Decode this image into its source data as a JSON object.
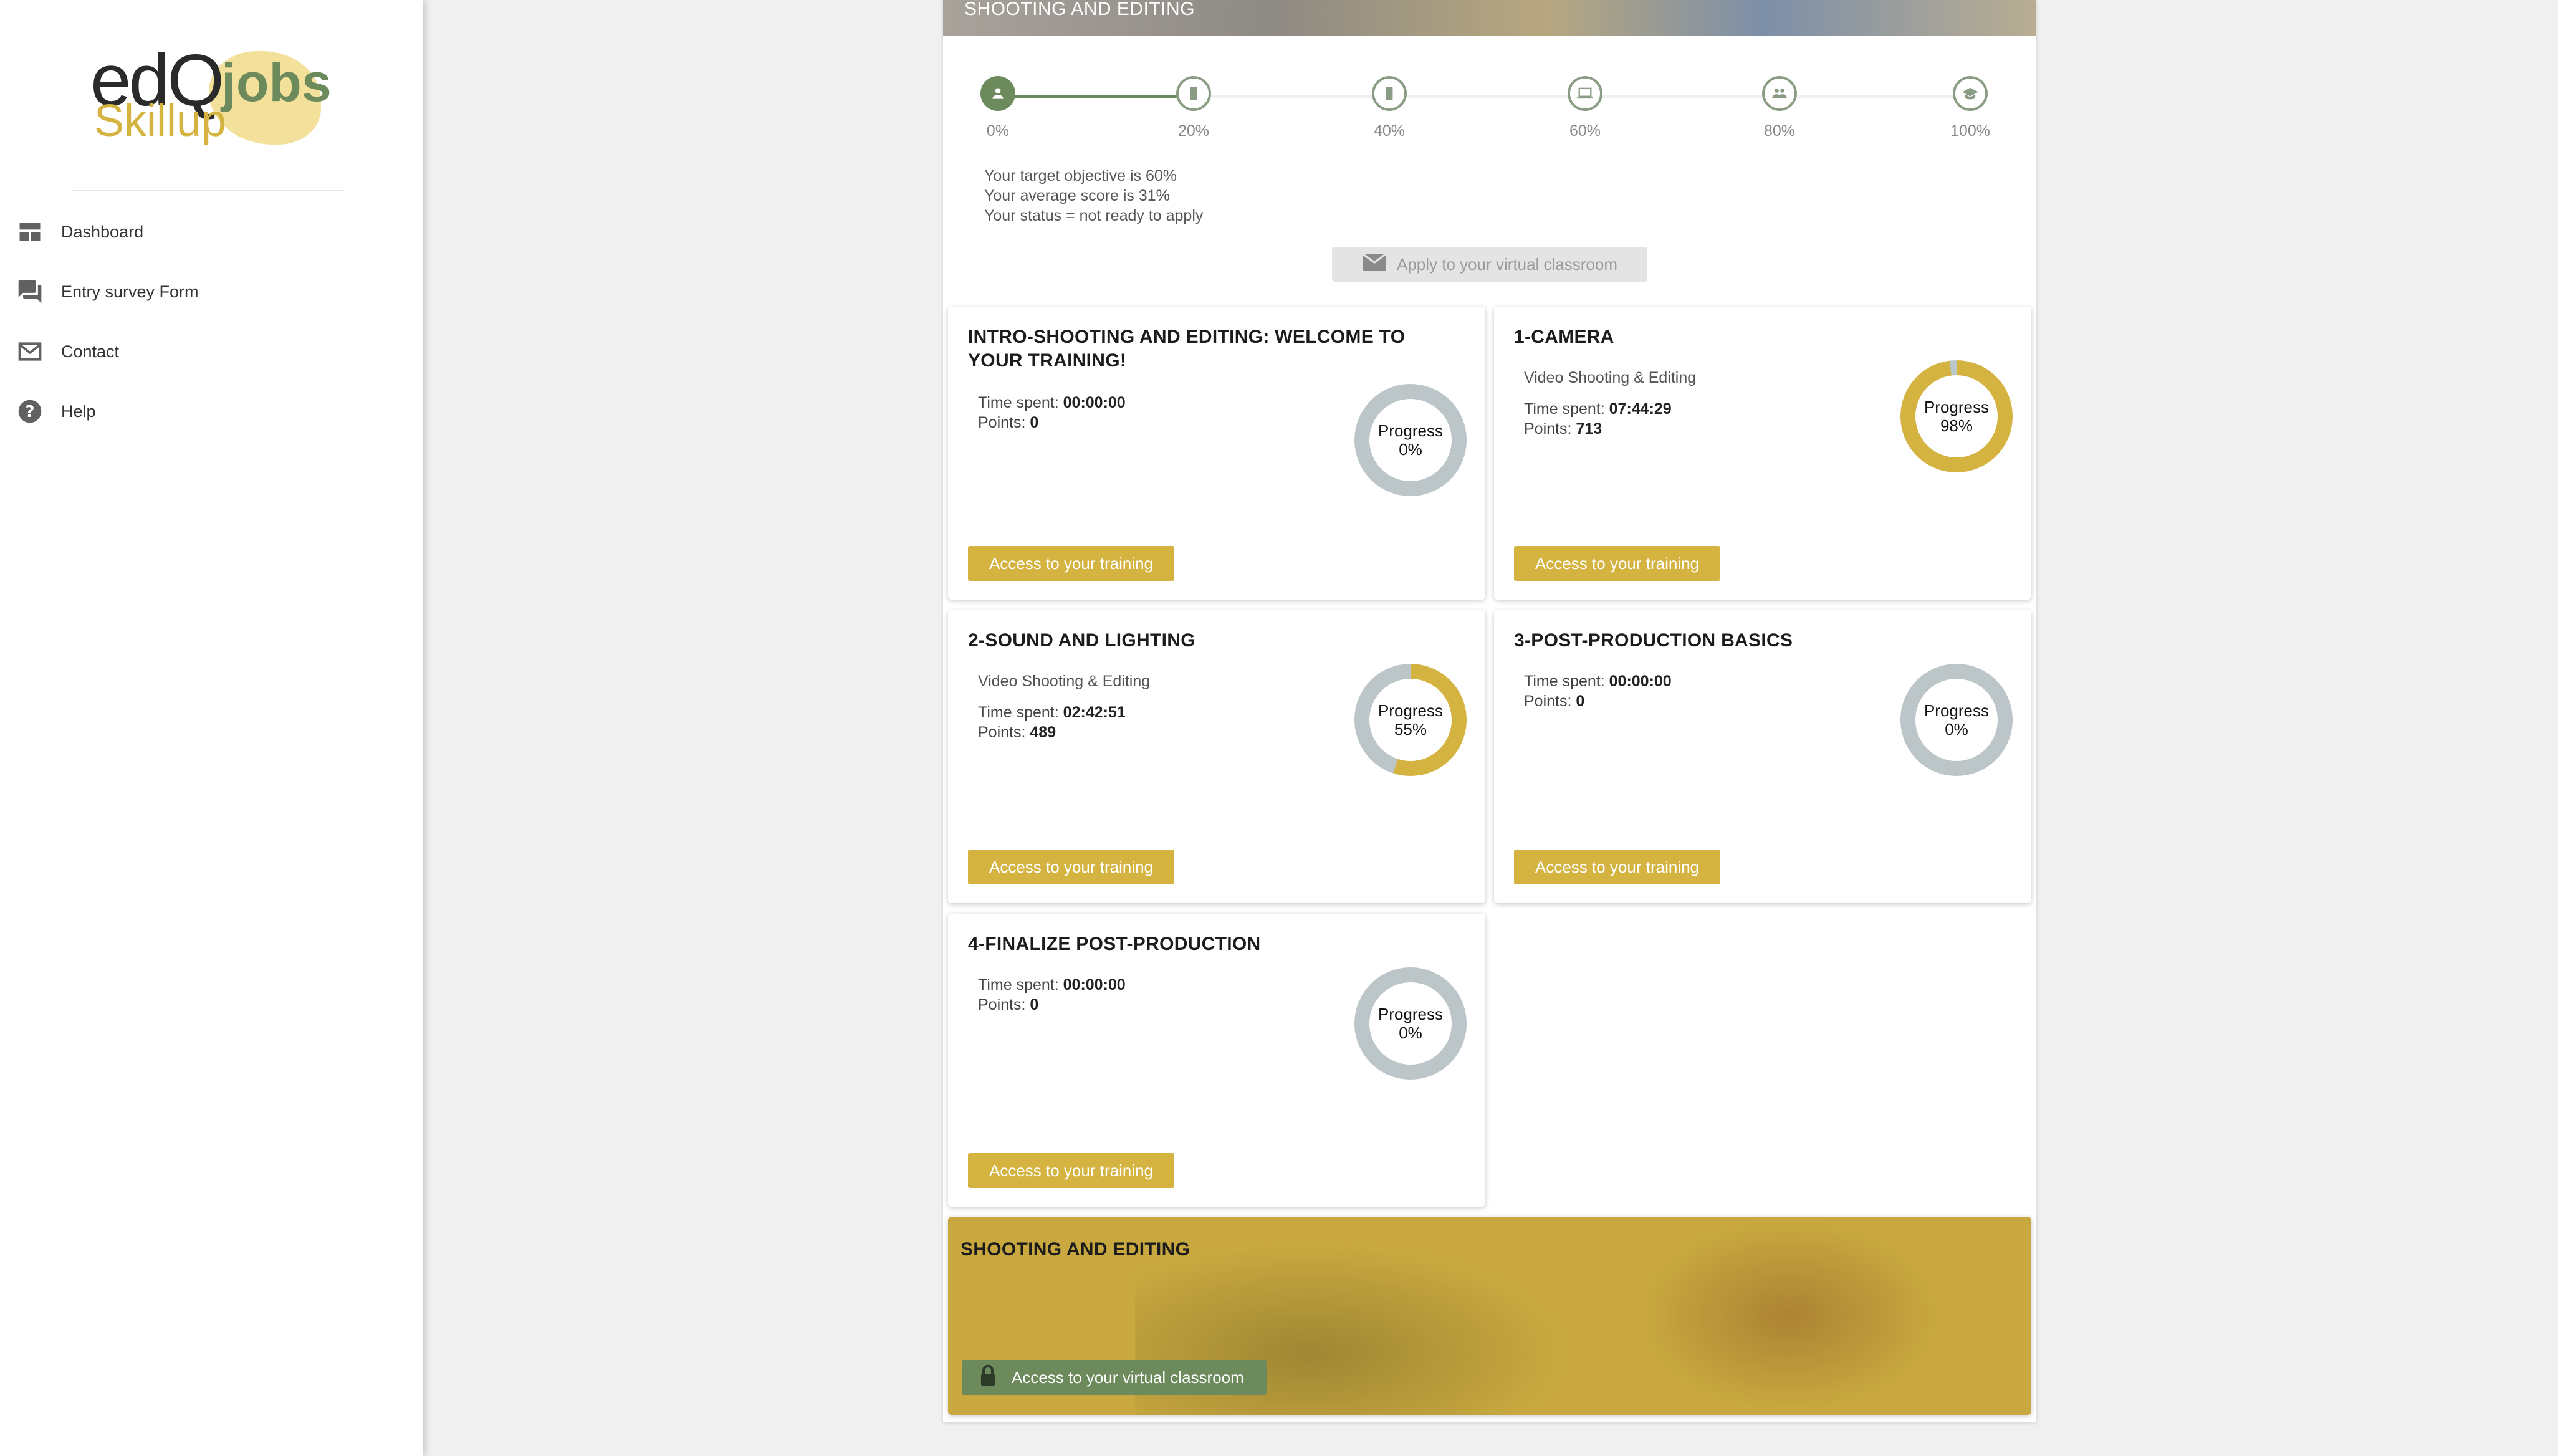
{
  "sidebar": {
    "logo": {
      "main": "edQ",
      "secondary": "Skillup",
      "accent": "jobs"
    },
    "items": [
      {
        "label": "Dashboard",
        "icon": "dashboard-icon"
      },
      {
        "label": "Entry survey Form",
        "icon": "forum-icon"
      },
      {
        "label": "Contact",
        "icon": "mail-icon"
      },
      {
        "label": "Help",
        "icon": "help-icon"
      }
    ]
  },
  "header": {
    "title": "SHOOTING AND EDITING"
  },
  "progress_steps": {
    "current_fraction": 0.2,
    "steps": [
      {
        "label": "0%",
        "icon": "person-icon"
      },
      {
        "label": "20%",
        "icon": "phone-icon"
      },
      {
        "label": "40%",
        "icon": "phone-icon"
      },
      {
        "label": "60%",
        "icon": "laptop-icon"
      },
      {
        "label": "80%",
        "icon": "group-icon"
      },
      {
        "label": "100%",
        "icon": "graduation-cap-icon"
      }
    ]
  },
  "objectives": {
    "target": "Your target objective is 60%",
    "average": "Your average score is 31%",
    "status": "Your status = not ready to apply"
  },
  "apply_button": {
    "label": "Apply to your virtual classroom",
    "icon": "mail-icon"
  },
  "labels": {
    "time_spent": "Time spent:",
    "points": "Points:",
    "progress": "Progress",
    "access": "Access to your training"
  },
  "courses": [
    {
      "title": "INTRO-SHOOTING AND EDITING: WELCOME TO YOUR TRAINING!",
      "subtitle": "",
      "time": "00:00:00",
      "points": "0",
      "progress": "0%",
      "progress_value": 0
    },
    {
      "title": "1-CAMERA",
      "subtitle": "Video Shooting & Editing",
      "time": "07:44:29",
      "points": "713",
      "progress": "98%",
      "progress_value": 98
    },
    {
      "title": "2-SOUND AND LIGHTING",
      "subtitle": "Video Shooting & Editing",
      "time": "02:42:51",
      "points": "489",
      "progress": "55%",
      "progress_value": 55
    },
    {
      "title": "3-POST-PRODUCTION BASICS",
      "subtitle": "",
      "time": "00:00:00",
      "points": "0",
      "progress": "0%",
      "progress_value": 0
    },
    {
      "title": "4-FINALIZE POST-PRODUCTION",
      "subtitle": "",
      "time": "00:00:00",
      "points": "0",
      "progress": "0%",
      "progress_value": 0
    }
  ],
  "classroom": {
    "title": "SHOOTING AND EDITING",
    "button_label": "Access to your virtual classroom",
    "icon": "lock-icon"
  },
  "colors": {
    "accent": "#d4b341",
    "green": "#6c8a5b",
    "track": "#bcc5c8"
  }
}
